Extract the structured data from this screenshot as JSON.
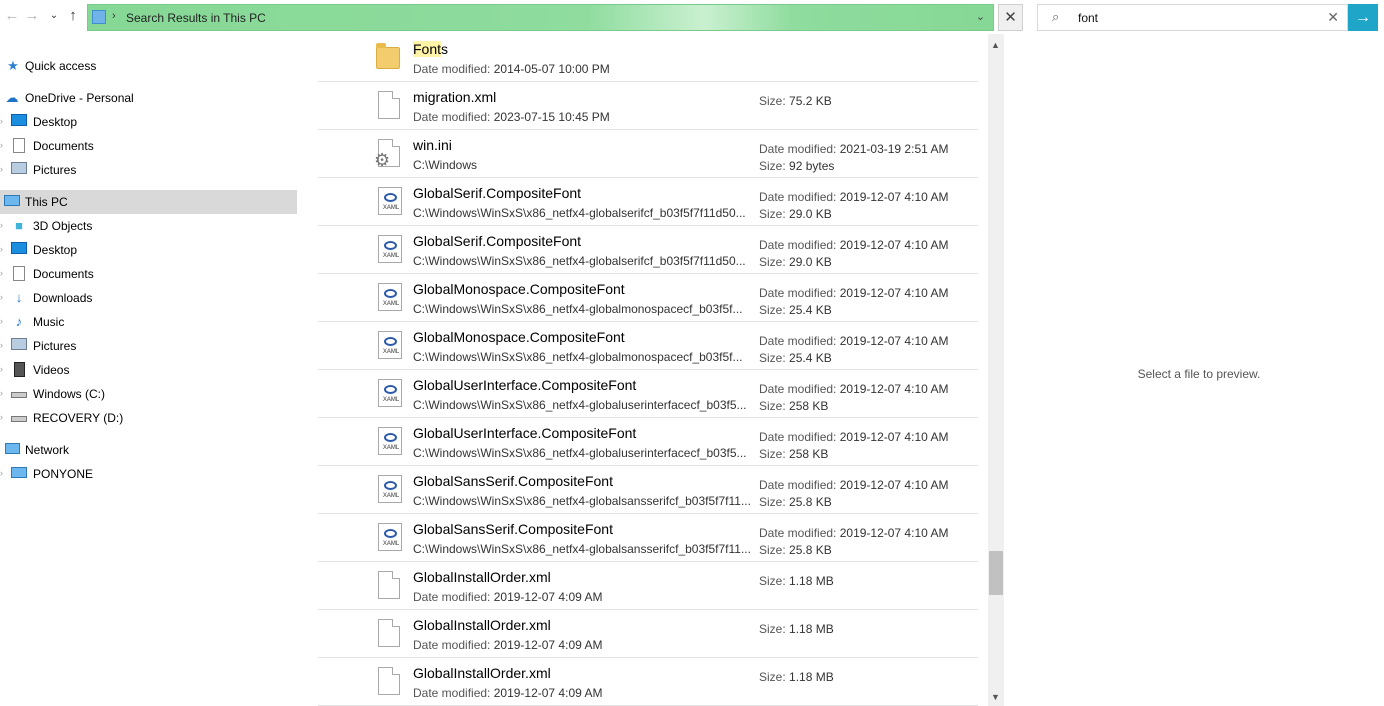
{
  "toolbar": {
    "back_icon": "arrow-left-icon",
    "forward_icon": "arrow-right-icon",
    "up_icon": "arrow-up-icon",
    "address_text": "Search Results in This PC",
    "search_query": "font",
    "preview_message": "Select a file to preview."
  },
  "sidebar": {
    "items": [
      {
        "label": "Quick access",
        "icon": "star-icon"
      },
      {
        "label": "OneDrive - Personal",
        "icon": "cloud-icon"
      },
      {
        "label": "Desktop",
        "icon": "desktop-icon"
      },
      {
        "label": "Documents",
        "icon": "documents-icon"
      },
      {
        "label": "Pictures",
        "icon": "pictures-icon"
      },
      {
        "label": "This PC",
        "icon": "computer-icon"
      },
      {
        "label": "3D Objects",
        "icon": "cube-icon"
      },
      {
        "label": "Desktop",
        "icon": "desktop-icon"
      },
      {
        "label": "Documents",
        "icon": "documents-icon"
      },
      {
        "label": "Downloads",
        "icon": "download-icon"
      },
      {
        "label": "Music",
        "icon": "music-icon"
      },
      {
        "label": "Pictures",
        "icon": "pictures-icon"
      },
      {
        "label": "Videos",
        "icon": "video-icon"
      },
      {
        "label": "Windows (C:)",
        "icon": "drive-icon"
      },
      {
        "label": "RECOVERY (D:)",
        "icon": "drive-icon"
      },
      {
        "label": "Network",
        "icon": "network-icon"
      },
      {
        "label": "PONYONE",
        "icon": "computer-icon"
      }
    ]
  },
  "files": [
    {
      "name": "Fonts",
      "icon": "folder-icon",
      "sub_key": "Date modified:",
      "sub_val": "2014-05-07 10:00 PM",
      "r1_key": "",
      "r1_val": "",
      "r2_key": "",
      "r2_val": ""
    },
    {
      "name": "migration.xml",
      "icon": "document-icon",
      "sub_key": "Date modified:",
      "sub_val": "2023-07-15 10:45 PM",
      "r1_key": "Size:",
      "r1_val": "75.2 KB",
      "r2_key": "",
      "r2_val": ""
    },
    {
      "name": "win.ini",
      "icon": "settings-file-icon",
      "sub_key": "",
      "sub_val": "C:\\Windows",
      "r1_key": "Date modified:",
      "r1_val": "2021-03-19 2:51 AM",
      "r2_key": "Size:",
      "r2_val": "92 bytes"
    },
    {
      "name": "GlobalSerif.CompositeFont",
      "icon": "xaml-file-icon",
      "sub_key": "",
      "sub_val": "C:\\Windows\\WinSxS\\x86_netfx4-globalserifcf_b03f5f7f11d50...",
      "r1_key": "Date modified:",
      "r1_val": "2019-12-07 4:10 AM",
      "r2_key": "Size:",
      "r2_val": "29.0 KB"
    },
    {
      "name": "GlobalSerif.CompositeFont",
      "icon": "xaml-file-icon",
      "sub_key": "",
      "sub_val": "C:\\Windows\\WinSxS\\x86_netfx4-globalserifcf_b03f5f7f11d50...",
      "r1_key": "Date modified:",
      "r1_val": "2019-12-07 4:10 AM",
      "r2_key": "Size:",
      "r2_val": "29.0 KB"
    },
    {
      "name": "GlobalMonospace.CompositeFont",
      "icon": "xaml-file-icon",
      "sub_key": "",
      "sub_val": "C:\\Windows\\WinSxS\\x86_netfx4-globalmonospacecf_b03f5f...",
      "r1_key": "Date modified:",
      "r1_val": "2019-12-07 4:10 AM",
      "r2_key": "Size:",
      "r2_val": "25.4 KB"
    },
    {
      "name": "GlobalMonospace.CompositeFont",
      "icon": "xaml-file-icon",
      "sub_key": "",
      "sub_val": "C:\\Windows\\WinSxS\\x86_netfx4-globalmonospacecf_b03f5f...",
      "r1_key": "Date modified:",
      "r1_val": "2019-12-07 4:10 AM",
      "r2_key": "Size:",
      "r2_val": "25.4 KB"
    },
    {
      "name": "GlobalUserInterface.CompositeFont",
      "icon": "xaml-file-icon",
      "sub_key": "",
      "sub_val": "C:\\Windows\\WinSxS\\x86_netfx4-globaluserinterfacecf_b03f5...",
      "r1_key": "Date modified:",
      "r1_val": "2019-12-07 4:10 AM",
      "r2_key": "Size:",
      "r2_val": "258 KB"
    },
    {
      "name": "GlobalUserInterface.CompositeFont",
      "icon": "xaml-file-icon",
      "sub_key": "",
      "sub_val": "C:\\Windows\\WinSxS\\x86_netfx4-globaluserinterfacecf_b03f5...",
      "r1_key": "Date modified:",
      "r1_val": "2019-12-07 4:10 AM",
      "r2_key": "Size:",
      "r2_val": "258 KB"
    },
    {
      "name": "GlobalSansSerif.CompositeFont",
      "icon": "xaml-file-icon",
      "sub_key": "",
      "sub_val": "C:\\Windows\\WinSxS\\x86_netfx4-globalsansserifcf_b03f5f7f11...",
      "r1_key": "Date modified:",
      "r1_val": "2019-12-07 4:10 AM",
      "r2_key": "Size:",
      "r2_val": "25.8 KB"
    },
    {
      "name": "GlobalSansSerif.CompositeFont",
      "icon": "xaml-file-icon",
      "sub_key": "",
      "sub_val": "C:\\Windows\\WinSxS\\x86_netfx4-globalsansserifcf_b03f5f7f11...",
      "r1_key": "Date modified:",
      "r1_val": "2019-12-07 4:10 AM",
      "r2_key": "Size:",
      "r2_val": "25.8 KB"
    },
    {
      "name": "GlobalInstallOrder.xml",
      "icon": "document-icon",
      "sub_key": "Date modified:",
      "sub_val": "2019-12-07 4:09 AM",
      "r1_key": "Size:",
      "r1_val": "1.18 MB",
      "r2_key": "",
      "r2_val": ""
    },
    {
      "name": "GlobalInstallOrder.xml",
      "icon": "document-icon",
      "sub_key": "Date modified:",
      "sub_val": "2019-12-07 4:09 AM",
      "r1_key": "Size:",
      "r1_val": "1.18 MB",
      "r2_key": "",
      "r2_val": ""
    },
    {
      "name": "GlobalInstallOrder.xml",
      "icon": "document-icon",
      "sub_key": "Date modified:",
      "sub_val": "2019-12-07 4:09 AM",
      "r1_key": "Size:",
      "r1_val": "1.18 MB",
      "r2_key": "",
      "r2_val": ""
    }
  ],
  "colors": {
    "address_bar": "#86d896",
    "go_button": "#1ea5c8",
    "selected_nav": "#d9d9d9",
    "highlight": "#fff3a8"
  }
}
